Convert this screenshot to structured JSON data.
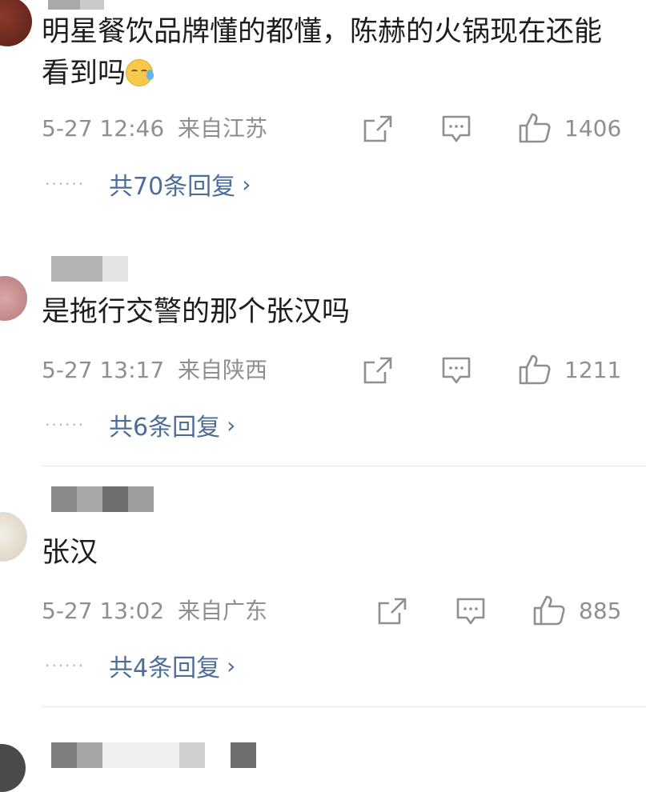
{
  "comments": [
    {
      "content": "明星餐饮品牌懂的都懂，陈赫的火锅现在还能看到吗",
      "time": "5-27 12:46",
      "location": "来自江苏",
      "likes": "1406",
      "replies_label": "共70条回复",
      "avatar_icon": "avatar-icon",
      "emoji": "sleepy-sweat-emoji"
    },
    {
      "content": "是拖行交警的那个张汉吗",
      "time": "5-27 13:17",
      "location": "来自陕西",
      "likes": "1211",
      "replies_label": "共6条回复",
      "avatar_icon": "avatar-icon"
    },
    {
      "content": "张汉",
      "time": "5-27 13:02",
      "location": "来自广东",
      "likes": "885",
      "replies_label": "共4条回复",
      "avatar_icon": "avatar-icon"
    }
  ],
  "icons": {
    "share": "share-icon",
    "comment": "comment-icon",
    "like": "thumbs-up-icon",
    "reply_arrow": "chevron-right-icon"
  },
  "colors": {
    "meta_text": "#8f8f8f",
    "reply_link": "#4d6d99",
    "content_text": "#1d1d1d"
  }
}
